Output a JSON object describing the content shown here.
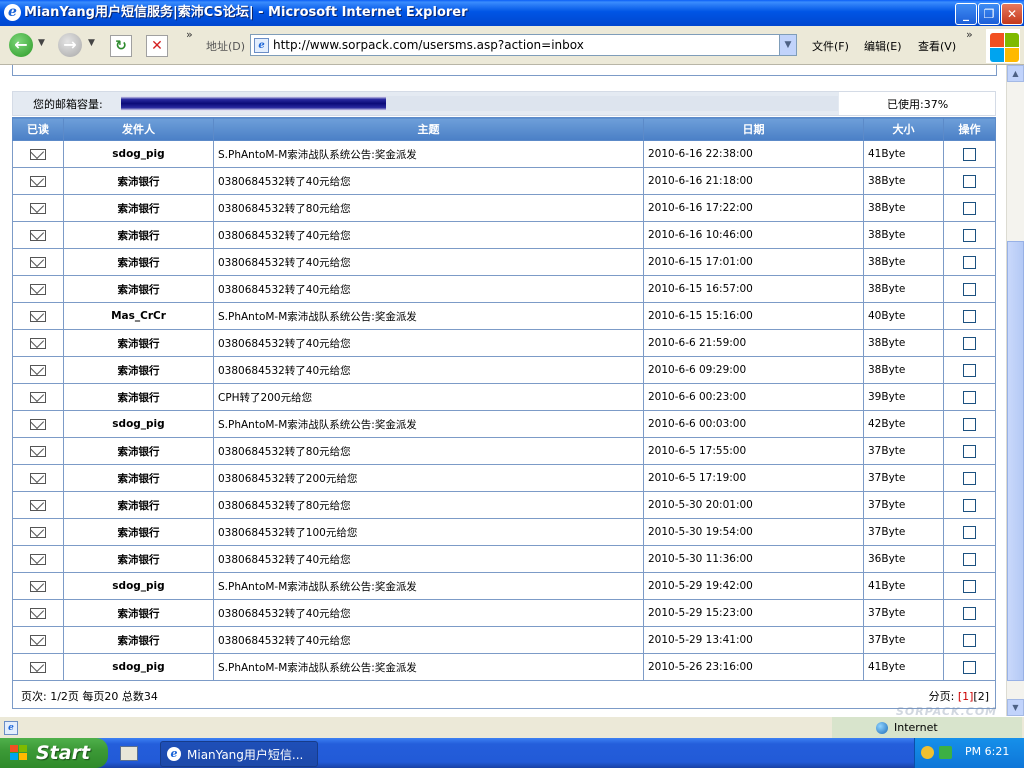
{
  "window": {
    "title": "MianYang用户短信服务|索沛CS论坛| - Microsoft Internet Explorer"
  },
  "toolbar": {
    "address_label": "地址(D)",
    "url": "http://www.sorpack.com/usersms.asp?action=inbox",
    "menus": [
      "文件(F)",
      "编辑(E)",
      "查看(V)"
    ]
  },
  "mailbox": {
    "quota_label": "您的邮箱容量:",
    "used_text": "已使用:37%",
    "used_fraction": 0.37
  },
  "table": {
    "headers": [
      "已读",
      "发件人",
      "主题",
      "日期",
      "大小",
      "操作"
    ],
    "rows": [
      {
        "sender": "sdog_pig",
        "subject": "S.PhAntoM-M索沛战队系统公告:奖金派发",
        "date": "2010-6-16 22:38:00",
        "size": "41Byte"
      },
      {
        "sender": "索沛银行",
        "subject": "0380684532转了40元给您",
        "date": "2010-6-16 21:18:00",
        "size": "38Byte"
      },
      {
        "sender": "索沛银行",
        "subject": "0380684532转了80元给您",
        "date": "2010-6-16 17:22:00",
        "size": "38Byte"
      },
      {
        "sender": "索沛银行",
        "subject": "0380684532转了40元给您",
        "date": "2010-6-16 10:46:00",
        "size": "38Byte"
      },
      {
        "sender": "索沛银行",
        "subject": "0380684532转了40元给您",
        "date": "2010-6-15 17:01:00",
        "size": "38Byte"
      },
      {
        "sender": "索沛银行",
        "subject": "0380684532转了40元给您",
        "date": "2010-6-15 16:57:00",
        "size": "38Byte"
      },
      {
        "sender": "Mas_CrCr",
        "subject": "S.PhAntoM-M索沛战队系统公告:奖金派发",
        "date": "2010-6-15 15:16:00",
        "size": "40Byte"
      },
      {
        "sender": "索沛银行",
        "subject": "0380684532转了40元给您",
        "date": "2010-6-6 21:59:00",
        "size": "38Byte"
      },
      {
        "sender": "索沛银行",
        "subject": "0380684532转了40元给您",
        "date": "2010-6-6 09:29:00",
        "size": "38Byte"
      },
      {
        "sender": "索沛银行",
        "subject": "CPH转了200元给您",
        "date": "2010-6-6 00:23:00",
        "size": "39Byte"
      },
      {
        "sender": "sdog_pig",
        "subject": "S.PhAntoM-M索沛战队系统公告:奖金派发",
        "date": "2010-6-6 00:03:00",
        "size": "42Byte"
      },
      {
        "sender": "索沛银行",
        "subject": "0380684532转了80元给您",
        "date": "2010-6-5 17:55:00",
        "size": "37Byte"
      },
      {
        "sender": "索沛银行",
        "subject": "0380684532转了200元给您",
        "date": "2010-6-5 17:19:00",
        "size": "37Byte"
      },
      {
        "sender": "索沛银行",
        "subject": "0380684532转了80元给您",
        "date": "2010-5-30 20:01:00",
        "size": "37Byte"
      },
      {
        "sender": "索沛银行",
        "subject": "0380684532转了100元给您",
        "date": "2010-5-30 19:54:00",
        "size": "37Byte"
      },
      {
        "sender": "索沛银行",
        "subject": "0380684532转了40元给您",
        "date": "2010-5-30 11:36:00",
        "size": "36Byte"
      },
      {
        "sender": "sdog_pig",
        "subject": "S.PhAntoM-M索沛战队系统公告:奖金派发",
        "date": "2010-5-29 19:42:00",
        "size": "41Byte"
      },
      {
        "sender": "索沛银行",
        "subject": "0380684532转了40元给您",
        "date": "2010-5-29 15:23:00",
        "size": "37Byte"
      },
      {
        "sender": "索沛银行",
        "subject": "0380684532转了40元给您",
        "date": "2010-5-29 13:41:00",
        "size": "37Byte"
      },
      {
        "sender": "sdog_pig",
        "subject": "S.PhAntoM-M索沛战队系统公告:奖金派发",
        "date": "2010-5-26 23:16:00",
        "size": "41Byte"
      }
    ]
  },
  "footer": {
    "page_info": "页次: 1/2页 每页20 总数34",
    "pager_label": "分页:",
    "pages": [
      "[1]",
      "[2]"
    ]
  },
  "statusbar": {
    "zone": "Internet"
  },
  "taskbar": {
    "start": "Start",
    "task": "MianYang用户短信...",
    "clock": "PM 6:21"
  },
  "colors": {
    "header_bg": "#4a7fc6",
    "border": "#7c9bc7",
    "quota_fill": "#0a0a78",
    "titlebar": "#0055e5"
  },
  "icons": [
    "ie-logo-icon",
    "back-arrow-icon",
    "forward-arrow-icon",
    "refresh-icon",
    "stop-icon",
    "page-icon",
    "windows-logo-icon",
    "envelope-icon",
    "globe-icon"
  ]
}
